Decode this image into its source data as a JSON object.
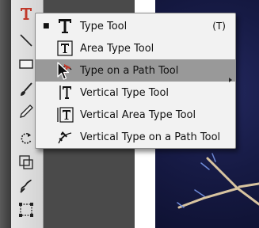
{
  "menu": {
    "items": [
      {
        "label": "Type Tool",
        "shortcut": "(T)",
        "checked": true,
        "icon": "type-tool-icon"
      },
      {
        "label": "Area Type Tool",
        "shortcut": "",
        "checked": false,
        "icon": "area-type-tool-icon"
      },
      {
        "label": "Type on a Path Tool",
        "shortcut": "",
        "checked": false,
        "icon": "type-on-path-tool-icon"
      },
      {
        "label": "Vertical Type Tool",
        "shortcut": "",
        "checked": false,
        "icon": "vertical-type-tool-icon"
      },
      {
        "label": "Vertical Area Type Tool",
        "shortcut": "",
        "checked": false,
        "icon": "vertical-area-type-tool-icon"
      },
      {
        "label": "Vertical Type on a Path Tool",
        "shortcut": "",
        "checked": false,
        "icon": "vertical-type-on-path-tool-icon"
      }
    ],
    "highlighted_index": 2,
    "checkmark": "■"
  },
  "colors": {
    "menu_bg": "#f2f2f2",
    "highlight": "#999999",
    "toolbar_bg": "#dddddd",
    "artboard": "#161a44",
    "art_lines": "#d8c4a0",
    "type_tool_red": "#c0392b"
  },
  "toolbar": {
    "tools": [
      "type-tool-icon",
      "line-segment-icon",
      "rectangle-icon",
      "paintbrush-icon",
      "pencil-icon",
      "rotate-icon",
      "scale-icon",
      "warp-icon",
      "free-transform-icon"
    ]
  }
}
